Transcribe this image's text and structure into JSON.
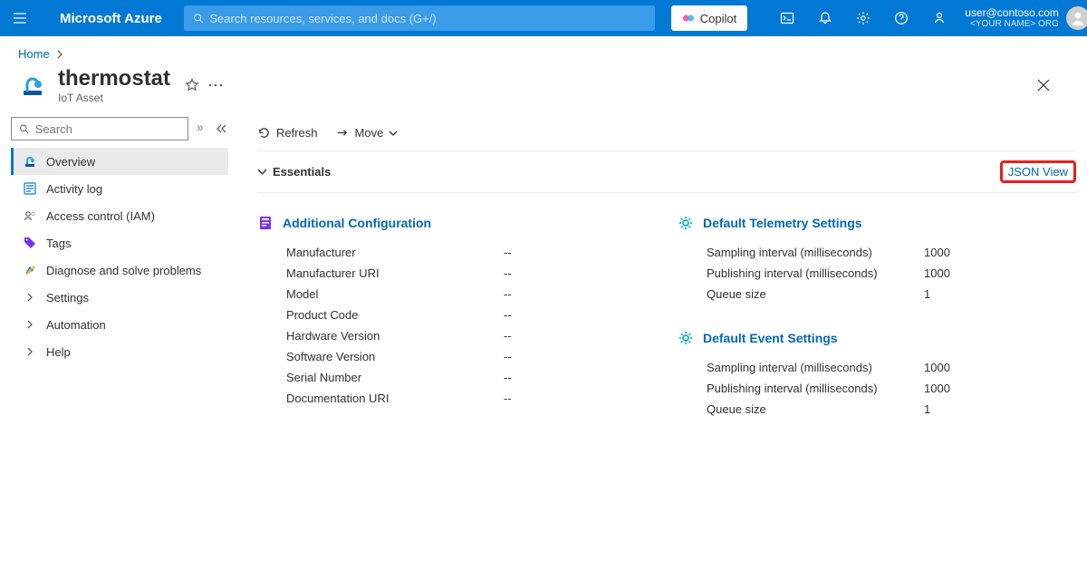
{
  "topbar": {
    "brand": "Microsoft Azure",
    "search_placeholder": "Search resources, services, and docs (G+/)",
    "copilot_label": "Copilot",
    "account_user": "user@contoso.com",
    "account_org": "<YOUR NAME> ORG"
  },
  "breadcrumb": {
    "items": [
      "Home"
    ]
  },
  "page": {
    "title": "thermostat",
    "subtitle": "IoT Asset"
  },
  "sidebar": {
    "search_placeholder": "Search",
    "items": [
      {
        "label": "Overview",
        "selected": true
      },
      {
        "label": "Activity log"
      },
      {
        "label": "Access control (IAM)"
      },
      {
        "label": "Tags"
      },
      {
        "label": "Diagnose and solve problems"
      },
      {
        "label": "Settings"
      },
      {
        "label": "Automation"
      },
      {
        "label": "Help"
      }
    ]
  },
  "toolbar": {
    "refresh_label": "Refresh",
    "move_label": "Move"
  },
  "essentials": {
    "label": "Essentials",
    "json_view_label": "JSON View"
  },
  "sections": {
    "additional_config": {
      "title": "Additional Configuration",
      "rows": [
        {
          "k": "Manufacturer",
          "v": "--"
        },
        {
          "k": "Manufacturer URI",
          "v": "--"
        },
        {
          "k": "Model",
          "v": "--"
        },
        {
          "k": "Product Code",
          "v": "--"
        },
        {
          "k": "Hardware Version",
          "v": "--"
        },
        {
          "k": "Software Version",
          "v": "--"
        },
        {
          "k": "Serial Number",
          "v": "--"
        },
        {
          "k": "Documentation URI",
          "v": "--"
        }
      ]
    },
    "telemetry": {
      "title": "Default Telemetry Settings",
      "rows": [
        {
          "k": "Sampling interval (milliseconds)",
          "v": "1000"
        },
        {
          "k": "Publishing interval (milliseconds)",
          "v": "1000"
        },
        {
          "k": "Queue size",
          "v": "1"
        }
      ]
    },
    "event": {
      "title": "Default Event Settings",
      "rows": [
        {
          "k": "Sampling interval (milliseconds)",
          "v": "1000"
        },
        {
          "k": "Publishing interval (milliseconds)",
          "v": "1000"
        },
        {
          "k": "Queue size",
          "v": "1"
        }
      ]
    }
  }
}
